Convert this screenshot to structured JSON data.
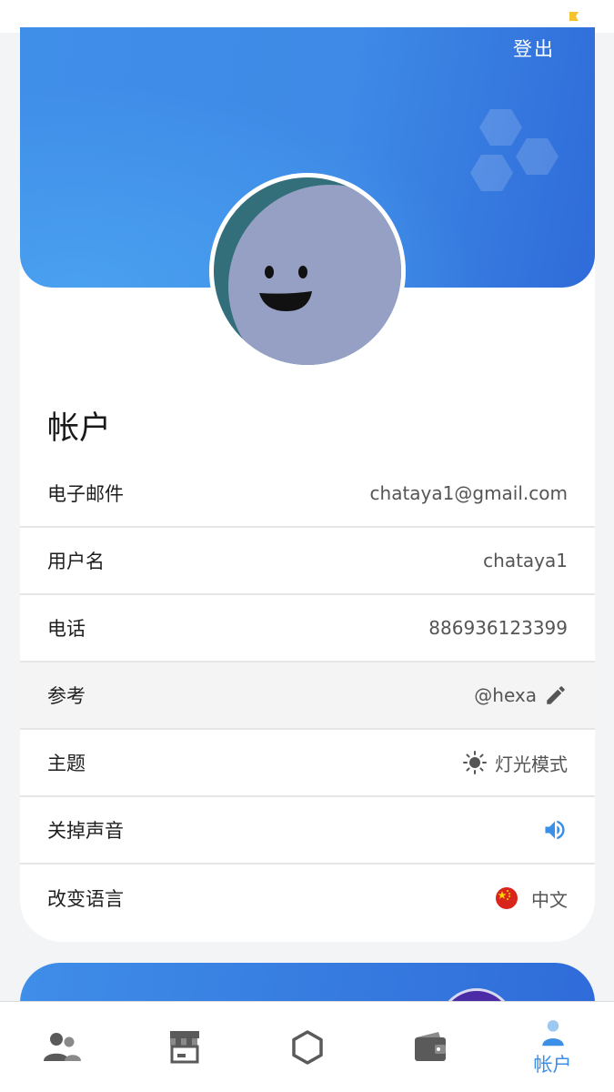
{
  "header": {
    "logout_label": "登出"
  },
  "account": {
    "title": "帐户",
    "rows": [
      {
        "label": "电子邮件",
        "value": "chataya1@gmail.com"
      },
      {
        "label": "用户名",
        "value": "chataya1"
      },
      {
        "label": "电话",
        "value": "886936123399"
      },
      {
        "label": "参考",
        "value": "@hexa",
        "icon": "pencil-icon"
      },
      {
        "label": "主题",
        "value": "灯光模式",
        "icon": "sun-icon"
      },
      {
        "label": "关掉声音",
        "value": "",
        "icon": "speaker-icon"
      },
      {
        "label": "改变语言",
        "value": "中文",
        "icon": "china-flag-icon"
      }
    ]
  },
  "tabs": [
    {
      "name": "people",
      "icon": "people-icon",
      "label": ""
    },
    {
      "name": "store",
      "icon": "store-icon",
      "label": ""
    },
    {
      "name": "hexa",
      "icon": "hexagon-icon",
      "label": ""
    },
    {
      "name": "wallet",
      "icon": "wallet-icon",
      "label": ""
    },
    {
      "name": "account",
      "icon": "user-icon",
      "label": "帐户",
      "active": true
    }
  ],
  "colors": {
    "accent": "#3b8fe6",
    "banner": "#3f8ee8",
    "avatar_bg": "#95a0c4",
    "avatar_ring": "#336e7b"
  }
}
